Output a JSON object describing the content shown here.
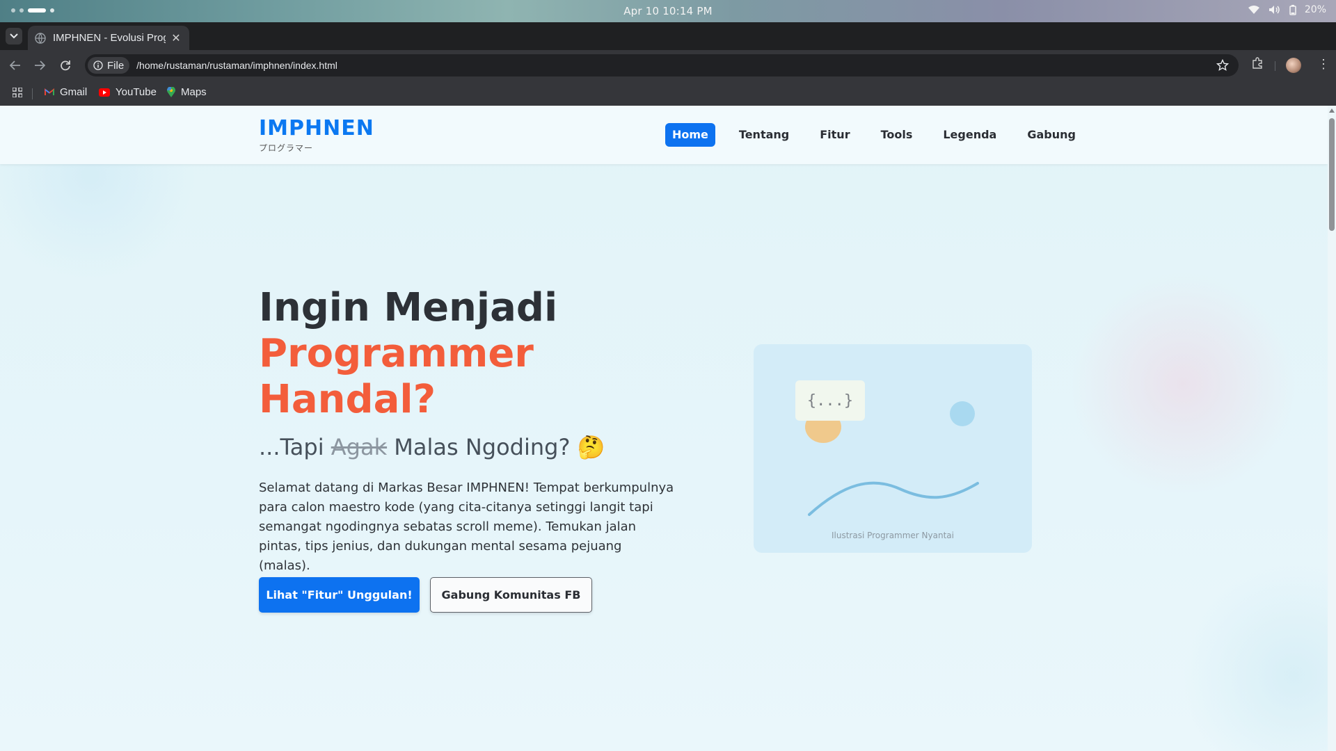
{
  "os": {
    "clock": "Apr 10  10:14 PM",
    "battery": "20%",
    "icons": [
      "wifi-icon",
      "volume-icon",
      "battery-icon"
    ]
  },
  "browser": {
    "tab_title": "IMPHNEN - Evolusi Progr",
    "new_tab": "+",
    "close_tab": "✕",
    "close_window": "✕",
    "url_chip": "File",
    "url": "/home/rustaman/rustaman/imphnen/index.html",
    "bookmarks": [
      {
        "label": "Gmail",
        "icon": "gmail-icon"
      },
      {
        "label": "YouTube",
        "icon": "youtube-icon"
      },
      {
        "label": "Maps",
        "icon": "maps-icon"
      }
    ]
  },
  "site": {
    "logo": "IMPHNEN",
    "logo_sub": "プログラマー",
    "nav": [
      {
        "label": "Home",
        "active": true
      },
      {
        "label": "Tentang",
        "active": false
      },
      {
        "label": "Fitur",
        "active": false
      },
      {
        "label": "Tools",
        "active": false
      },
      {
        "label": "Legenda",
        "active": false
      },
      {
        "label": "Gabung",
        "active": false
      }
    ]
  },
  "hero": {
    "title_line1": "Ingin Menjadi",
    "title_line2": "Programmer",
    "title_line3": "Handal?",
    "sub_prefix": "...Tapi ",
    "sub_strike": "Agak",
    "sub_suffix": " Malas Ngoding? 🤔",
    "description": "Selamat datang di Markas Besar IMPHNEN! Tempat berkumpulnya para calon maestro kode (yang cita-citanya setinggi langit tapi semangat ngodingnya sebatas scroll meme). Temukan jalan pintas, tips jenius, dan dukungan mental sesama pejuang (malas).",
    "btn_primary": "Lihat \"Fitur\" Unggulan!",
    "btn_secondary": "Gabung Komunitas FB",
    "illustration_code": "{...}",
    "illustration_caption": "Ilustrasi Programmer Nyantai"
  },
  "colors": {
    "accent_blue": "#0d72f0",
    "accent_orange": "#f35d3b",
    "text_dark": "#2d3137"
  }
}
